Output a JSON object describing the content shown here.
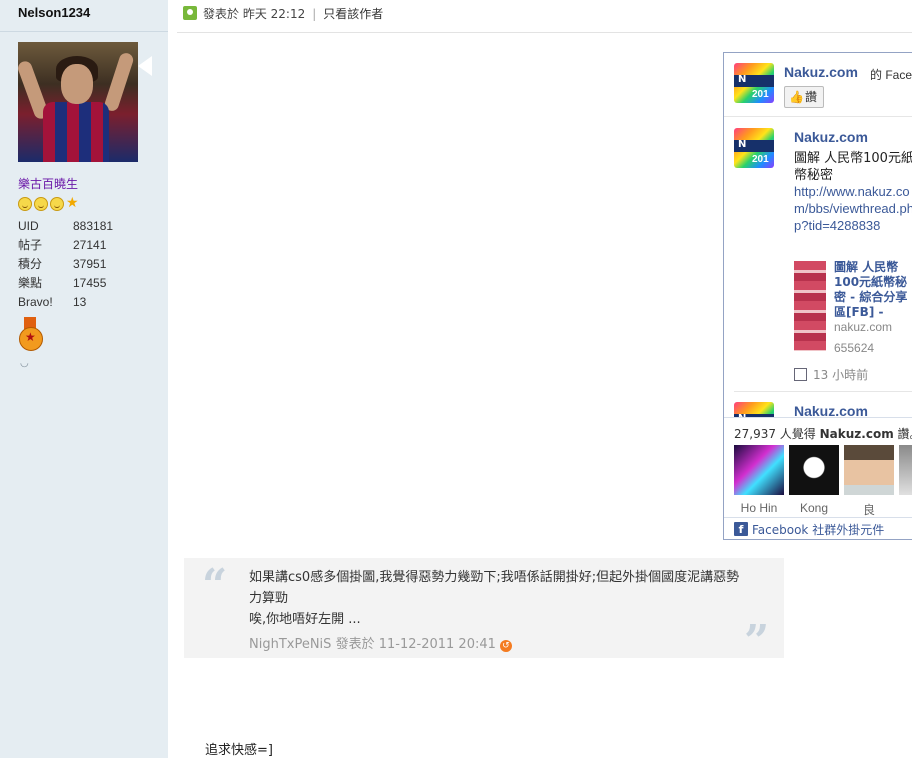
{
  "user": {
    "name": "Nelson1234",
    "group": "樂古百曉生",
    "stats": [
      {
        "key": "UID",
        "value": "883181"
      },
      {
        "key": "帖子",
        "value": "27141"
      },
      {
        "key": "積分",
        "value": "37951"
      },
      {
        "key": "樂點",
        "value": "17455"
      },
      {
        "key": "Bravo!",
        "value": "13"
      }
    ]
  },
  "post_header": {
    "posted_label": "發表於",
    "time": "昨天 22:12",
    "separator": "|",
    "only_author": "只看該作者"
  },
  "fb": {
    "page_name": "Nakuz.com",
    "of_suffix": "的 Facebook",
    "like_label": "讚",
    "post1": {
      "author": "Nakuz.com",
      "text": "圖解 人民幣100元紙幣秘密",
      "link": "http://www.nakuz.com/bbs/viewthread.php?tid=4288838",
      "attachment_title": "圖解 人民幣100元紙幣秘密 - 綜合分享區[FB] -",
      "attachment_domain": "nakuz.com",
      "attachment_count": "655624",
      "time": "13 小時前"
    },
    "post2_author": "Nakuz.com",
    "fans_count": "27,937 人覺得",
    "fans_page": "Nakuz.com",
    "fans_suffix": "讚。",
    "fans": [
      {
        "name": "Ho Hin"
      },
      {
        "name": "Kong"
      },
      {
        "name": "良"
      },
      {
        "name": ""
      }
    ],
    "footer": "Facebook 社群外掛元件"
  },
  "quote": {
    "lines": [
      "如果講cs0感多個掛圖,我覺得惡勢力幾勁下;我唔係話開掛好;但起外掛個國度泥講惡勢力算勁",
      "唉,你地唔好左開 ..."
    ],
    "author": "NighTxPeNiS",
    "posted_label": "發表於",
    "time": "11-12-2011 20:41"
  },
  "reply_text": "追求快感=]"
}
